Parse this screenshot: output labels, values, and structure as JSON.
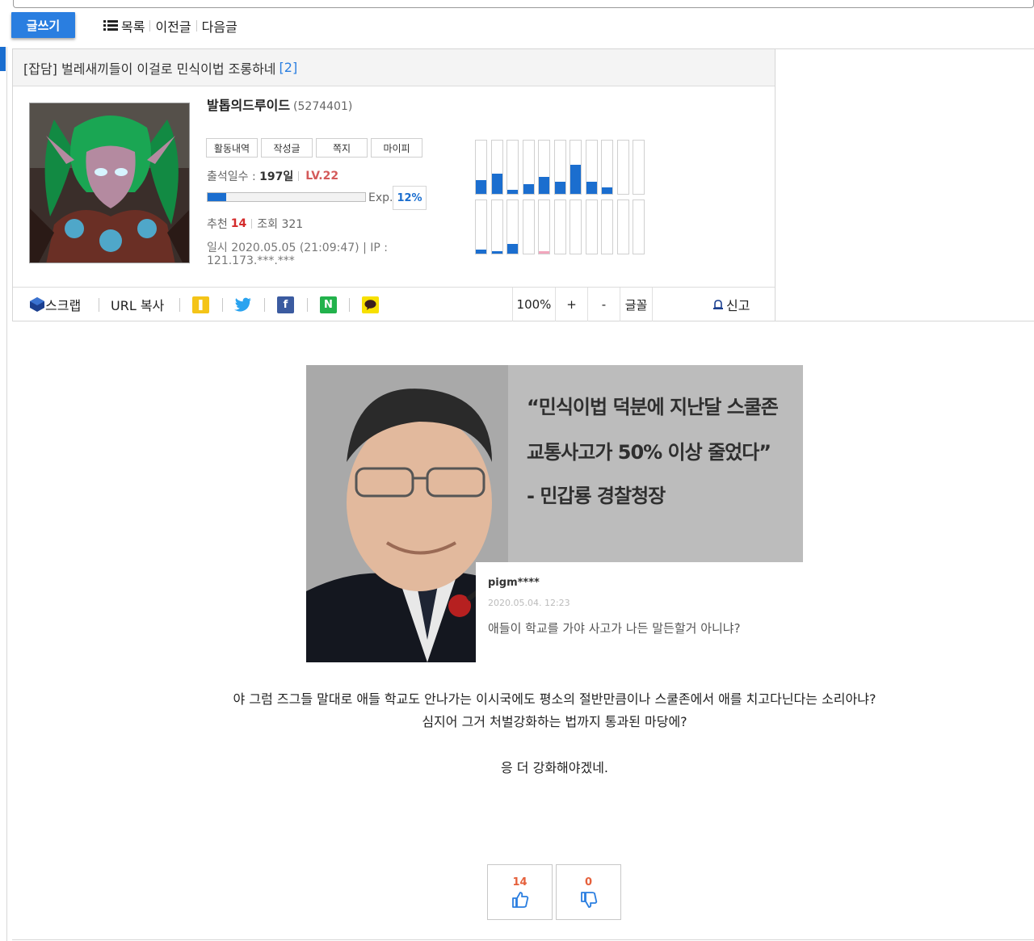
{
  "toolbar": {
    "write_label": "글쓰기",
    "list_label": "목록",
    "prev_label": "이전글",
    "next_label": "다음글"
  },
  "post": {
    "category": "[잡담]",
    "title": "벌레새끼들이 이걸로 민식이법 조롱하네",
    "comment_count": "[2]"
  },
  "author": {
    "nickname": "발톱의드루이드",
    "user_id": "(5274401)",
    "buttons": [
      "활동내역",
      "작성글",
      "쪽지",
      "마이피"
    ],
    "attendance_label": "출석일수 :",
    "attendance_value": "197일",
    "level": "LV.22",
    "exp_label": "Exp.",
    "exp_percent": "12%",
    "exp_fraction": 0.12,
    "recommend_label": "추천",
    "recommend_value": "14",
    "views_label": "조회 321",
    "date_ip": "일시 2020.05.05 (21:09:47) | IP : 121.173.***.***"
  },
  "activity_chart": {
    "upper_levels": [
      0.25,
      0.38,
      0.08,
      0.18,
      0.32,
      0.22,
      0.55,
      0.22,
      0.12,
      0,
      0
    ],
    "lower_levels": [
      0.08,
      0.04,
      0.18,
      0,
      0.04,
      0,
      0,
      0,
      0,
      0,
      0
    ],
    "lower_colors": [
      "#1b6ecf",
      "#1b6ecf",
      "#1b6ecf",
      "#1b6ecf",
      "#f2a6bd",
      "#1b6ecf",
      "#1b6ecf",
      "#1b6ecf",
      "#1b6ecf",
      "#1b6ecf",
      "#1b6ecf"
    ],
    "bar_color": "#1b6ecf"
  },
  "share": {
    "scrap_label": "스크랩",
    "url_copy_label": "URL 복사",
    "zoom": "100%",
    "zoom_in": "+",
    "zoom_out": "-",
    "font_label": "글꼴",
    "report_label": "신고"
  },
  "image": {
    "quote_line1": "“민식이법 덕분에 지난달 스쿨존",
    "quote_line2": "교통사고가 50% 이상 줄었다”",
    "quote_line3": "- 민갑룡 경찰청장",
    "comment_user": "pigm****",
    "comment_date": "2020.05.04. 12:23",
    "comment_text": "애들이 학교를 가야 사고가 나든 말든할거 아니냐?"
  },
  "body": {
    "line1": "야 그럼 즈그들 말대로 애들 학교도 안나가는 이시국에도 평소의 절반만큼이나 스쿨존에서 애를 치고다닌다는 소리아냐?",
    "line2": "심지어 그거 처벌강화하는 법까지 통과된 마당에?",
    "line3": "응 더 강화해야겠네."
  },
  "votes": {
    "up": "14",
    "down": "0"
  },
  "colors": {
    "accent": "#2a7ee0",
    "level": "#d45a5a",
    "vote": "#e5603b"
  }
}
